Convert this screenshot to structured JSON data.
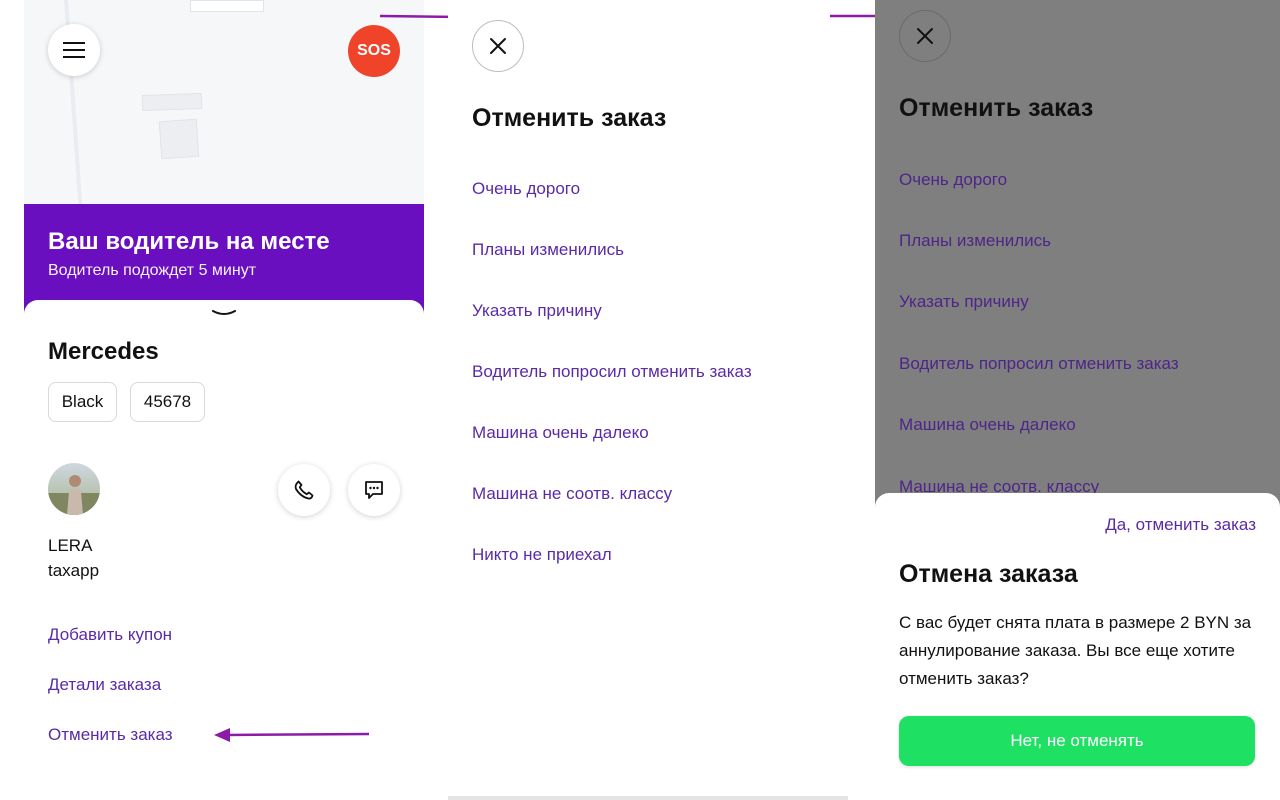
{
  "panel1": {
    "sos_label": "SOS",
    "banner": {
      "title": "Ваш водитель на месте",
      "subtitle": "Водитель подождет 5 минут"
    },
    "car": {
      "name": "Mercedes",
      "color": "Black",
      "plate": "45678"
    },
    "driver": {
      "name": "LERA",
      "app": "taxapp"
    },
    "links": {
      "coupon": "Добавить купон",
      "details": "Детали заказа",
      "cancel": "Отменить заказ"
    },
    "icons": [
      "menu-icon",
      "phone-icon",
      "chat-icon",
      "chevron-down-icon"
    ]
  },
  "panel2": {
    "title": "Отменить заказ",
    "reasons": [
      "Очень дорого",
      "Планы изменились",
      "Указать причину",
      "Водитель попросил отменить заказ",
      "Машина очень далеко",
      "Машина не соотв. классу",
      "Никто не приехал"
    ]
  },
  "panel3": {
    "title": "Отменить заказ",
    "reasons": [
      "Очень дорого",
      "Планы изменились",
      "Указать причину",
      "Водитель попросил отменить заказ",
      "Машина очень далеко",
      "Машина не соотв. классу"
    ],
    "dialog": {
      "confirm_label": "Да, отменить заказ",
      "title": "Отмена заказа",
      "body": "С вас будет снята плата в размере 2 BYN за аннулирование заказа. Вы все еще хотите отменить заказ?",
      "keep_label": "Нет, не отменять"
    }
  },
  "colors": {
    "brand_purple": "#6a0fc0",
    "link_purple": "#5b2aa6",
    "sos_red": "#f0442a",
    "green": "#1ee063",
    "arrow": "#8e1aa8",
    "overlay": "#7f7f7f"
  }
}
